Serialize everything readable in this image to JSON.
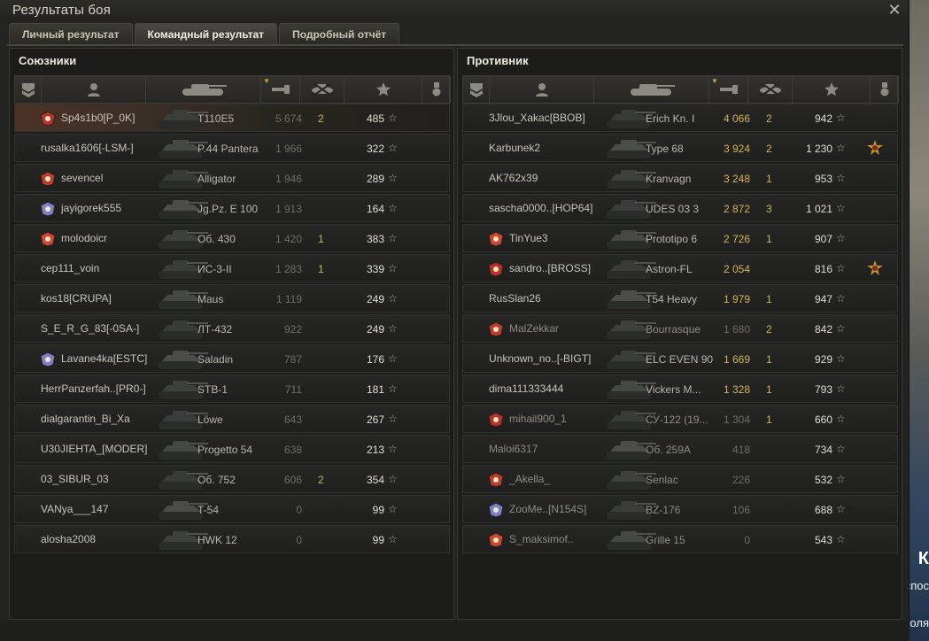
{
  "window": {
    "title": "Результаты боя",
    "close_icon": "close-icon"
  },
  "tabs": [
    {
      "label": "Личный результат",
      "active": false
    },
    {
      "label": "Командный результат",
      "active": true
    },
    {
      "label": "Подробный отчёт",
      "active": false
    }
  ],
  "allies": {
    "title": "Союзники",
    "players": [
      {
        "name": "Sp4s1b0[P_0K]",
        "clan_icon": true,
        "vehicle": "T110E5",
        "damage": "5 674",
        "frags": "2",
        "xp": "485",
        "highlight": true,
        "dim": false,
        "gold_dmg": false,
        "medal": false
      },
      {
        "name": "rusalka1606[-LSM-]",
        "clan_icon": false,
        "vehicle": "P.44 Pantera",
        "damage": "1 966",
        "frags": "",
        "xp": "322",
        "highlight": false,
        "dim": false,
        "gold_dmg": false,
        "medal": false
      },
      {
        "name": "sevencel",
        "clan_icon": true,
        "vehicle": "Alligator",
        "damage": "1 946",
        "frags": "",
        "xp": "289",
        "highlight": false,
        "dim": false,
        "gold_dmg": false,
        "medal": false
      },
      {
        "name": "jayigorek555",
        "clan_icon": true,
        "vehicle": "Jg.Pz. E 100",
        "damage": "1 913",
        "frags": "",
        "xp": "164",
        "highlight": false,
        "dim": false,
        "gold_dmg": false,
        "medal": false
      },
      {
        "name": "molodoicr",
        "clan_icon": true,
        "vehicle": "Об. 430",
        "damage": "1 420",
        "frags": "1",
        "xp": "383",
        "highlight": false,
        "dim": false,
        "gold_dmg": false,
        "medal": false
      },
      {
        "name": "cep111_voin",
        "clan_icon": false,
        "vehicle": "ИС-3-II",
        "damage": "1 283",
        "frags": "1",
        "xp": "339",
        "highlight": false,
        "dim": false,
        "gold_dmg": false,
        "medal": false
      },
      {
        "name": "kos18[CRUPA]",
        "clan_icon": false,
        "vehicle": "Maus",
        "damage": "1 119",
        "frags": "",
        "xp": "249",
        "highlight": false,
        "dim": false,
        "gold_dmg": false,
        "medal": false
      },
      {
        "name": "S_E_R_G_83[-0SA-]",
        "clan_icon": false,
        "vehicle": "ЛТ-432",
        "damage": "922",
        "frags": "",
        "xp": "249",
        "highlight": false,
        "dim": false,
        "gold_dmg": false,
        "medal": false
      },
      {
        "name": "Lavane4ka[ESTC]",
        "clan_icon": true,
        "vehicle": "Saladin",
        "damage": "787",
        "frags": "",
        "xp": "176",
        "highlight": false,
        "dim": false,
        "gold_dmg": false,
        "medal": false
      },
      {
        "name": "HerrPanzerfah..[PR0-]",
        "clan_icon": false,
        "vehicle": "STB-1",
        "damage": "711",
        "frags": "",
        "xp": "181",
        "highlight": false,
        "dim": false,
        "gold_dmg": false,
        "medal": false
      },
      {
        "name": "dialgarantin_Bi_Xa",
        "clan_icon": false,
        "vehicle": "Löwe",
        "damage": "643",
        "frags": "",
        "xp": "267",
        "highlight": false,
        "dim": false,
        "gold_dmg": false,
        "medal": false
      },
      {
        "name": "U30JIEHTA_[MODER]",
        "clan_icon": false,
        "vehicle": "Progetto 54",
        "damage": "638",
        "frags": "",
        "xp": "213",
        "highlight": false,
        "dim": false,
        "gold_dmg": false,
        "medal": false
      },
      {
        "name": "03_SIBUR_03",
        "clan_icon": false,
        "vehicle": "Об. 752",
        "damage": "606",
        "frags": "2",
        "xp": "354",
        "highlight": false,
        "dim": false,
        "gold_dmg": false,
        "medal": false
      },
      {
        "name": "VANya___147",
        "clan_icon": false,
        "vehicle": "T-54",
        "damage": "0",
        "frags": "",
        "xp": "99",
        "highlight": false,
        "dim": false,
        "gold_dmg": false,
        "medal": false
      },
      {
        "name": "alosha2008",
        "clan_icon": false,
        "vehicle": "HWK 12",
        "damage": "0",
        "frags": "",
        "xp": "99",
        "highlight": false,
        "dim": false,
        "gold_dmg": false,
        "medal": false
      }
    ]
  },
  "enemies": {
    "title": "Противник",
    "players": [
      {
        "name": "3Jlou_Xakac[BBOB]",
        "clan_icon": false,
        "vehicle": "Erich Kn. I",
        "damage": "4 066",
        "frags": "2",
        "xp": "942",
        "highlight": false,
        "dim": false,
        "gold_dmg": true,
        "medal": false
      },
      {
        "name": "Karbunek2",
        "clan_icon": false,
        "vehicle": "Type 68",
        "damage": "3 924",
        "frags": "2",
        "xp": "1 230",
        "highlight": false,
        "dim": false,
        "gold_dmg": true,
        "medal": true
      },
      {
        "name": "AK762x39",
        "clan_icon": false,
        "vehicle": "Kranvagn",
        "damage": "3 248",
        "frags": "1",
        "xp": "953",
        "highlight": false,
        "dim": false,
        "gold_dmg": true,
        "medal": false
      },
      {
        "name": "sascha0000..[HOP64]",
        "clan_icon": false,
        "vehicle": "UDES 03 3",
        "damage": "2 872",
        "frags": "3",
        "xp": "1 021",
        "highlight": false,
        "dim": false,
        "gold_dmg": true,
        "medal": false
      },
      {
        "name": "TinYue3",
        "clan_icon": true,
        "vehicle": "Prototipo 6",
        "damage": "2 726",
        "frags": "1",
        "xp": "907",
        "highlight": false,
        "dim": false,
        "gold_dmg": true,
        "medal": false
      },
      {
        "name": "sandro..[BROSS]",
        "clan_icon": true,
        "vehicle": "Astron-FL",
        "damage": "2 054",
        "frags": "",
        "xp": "816",
        "highlight": false,
        "dim": false,
        "gold_dmg": true,
        "medal": true
      },
      {
        "name": "RusSlan26",
        "clan_icon": false,
        "vehicle": "T54 Heavy",
        "damage": "1 979",
        "frags": "1",
        "xp": "947",
        "highlight": false,
        "dim": false,
        "gold_dmg": true,
        "medal": false
      },
      {
        "name": "MalZekkar",
        "clan_icon": true,
        "vehicle": "Bourrasque",
        "damage": "1 680",
        "frags": "2",
        "xp": "842",
        "highlight": false,
        "dim": true,
        "gold_dmg": false,
        "medal": false
      },
      {
        "name": "Unknown_no..[-BIGT]",
        "clan_icon": false,
        "vehicle": "ELC EVEN 90",
        "damage": "1 669",
        "frags": "1",
        "xp": "929",
        "highlight": false,
        "dim": false,
        "gold_dmg": true,
        "medal": false
      },
      {
        "name": "dima111333444",
        "clan_icon": false,
        "vehicle": "Vickers M...",
        "damage": "1 328",
        "frags": "1",
        "xp": "793",
        "highlight": false,
        "dim": false,
        "gold_dmg": true,
        "medal": false
      },
      {
        "name": "mihail900_1",
        "clan_icon": true,
        "vehicle": "СУ-122 (19...",
        "damage": "1 304",
        "frags": "1",
        "xp": "660",
        "highlight": false,
        "dim": true,
        "gold_dmg": false,
        "medal": false
      },
      {
        "name": "Maloi6317",
        "clan_icon": false,
        "vehicle": "Об. 259А",
        "damage": "418",
        "frags": "",
        "xp": "734",
        "highlight": false,
        "dim": true,
        "gold_dmg": false,
        "medal": false
      },
      {
        "name": "_Akella_",
        "clan_icon": true,
        "vehicle": "Senlac",
        "damage": "226",
        "frags": "",
        "xp": "532",
        "highlight": false,
        "dim": true,
        "gold_dmg": false,
        "medal": false
      },
      {
        "name": "ZooMe..[N154S]",
        "clan_icon": true,
        "vehicle": "BZ-176",
        "damage": "106",
        "frags": "",
        "xp": "688",
        "highlight": false,
        "dim": true,
        "gold_dmg": false,
        "medal": false
      },
      {
        "name": "S_maksimof..",
        "clan_icon": true,
        "vehicle": "Grille 15",
        "damage": "0",
        "frags": "",
        "xp": "543",
        "highlight": false,
        "dim": true,
        "gold_dmg": false,
        "medal": false
      }
    ]
  },
  "columns": [
    {
      "name": "rank-col",
      "icon": "rank-icon"
    },
    {
      "name": "player-col",
      "icon": "player-icon"
    },
    {
      "name": "vehicle-col",
      "icon": "tank-icon"
    },
    {
      "name": "damage-col",
      "icon": "damage-icon",
      "sorted": true
    },
    {
      "name": "frags-col",
      "icon": "frags-icon"
    },
    {
      "name": "xp-col",
      "icon": "star-icon"
    },
    {
      "name": "medal-col",
      "icon": "medal-icon"
    }
  ],
  "colors": {
    "gold": "#d4b35b",
    "highlight_row": "#4b3326",
    "panel": "#1c1c1a"
  },
  "backdrop_text": [
    "К",
    "спос",
    "оля"
  ]
}
